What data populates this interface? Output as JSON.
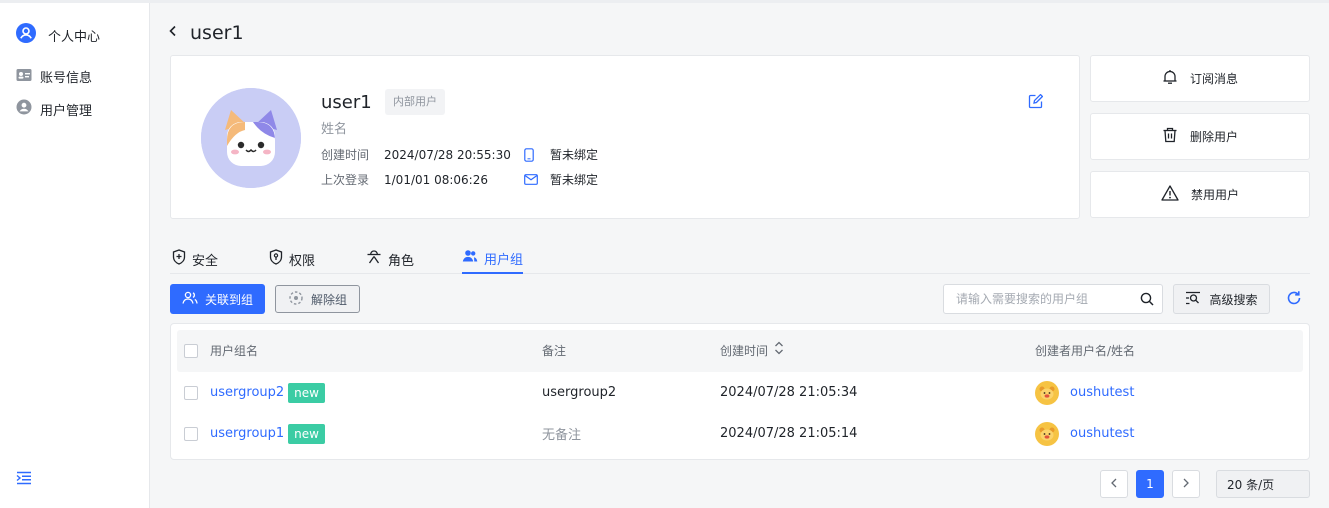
{
  "sidebar": {
    "header_label": "个人中心",
    "items": [
      {
        "label": "账号信息",
        "icon": "id-card-icon"
      },
      {
        "label": "用户管理",
        "icon": "user-circle-icon"
      }
    ]
  },
  "header": {
    "title": "user1"
  },
  "profile": {
    "name": "user1",
    "tag": "内部用户",
    "subtitle": "姓名",
    "created_label": "创建时间",
    "created_value": "2024/07/28 20:55:30",
    "last_login_label": "上次登录",
    "last_login_value": "1/01/01 08:06:26",
    "phone_status": "暂未绑定",
    "email_status": "暂未绑定"
  },
  "actions": {
    "subscribe": "订阅消息",
    "delete": "删除用户",
    "disable": "禁用用户"
  },
  "tabs": [
    {
      "label": "安全",
      "icon": "shield-icon"
    },
    {
      "label": "权限",
      "icon": "shield-lock-icon"
    },
    {
      "label": "角色",
      "icon": "role-icon"
    },
    {
      "label": "用户组",
      "icon": "users-icon",
      "active": true
    }
  ],
  "toolbar": {
    "link_group": "关联到组",
    "unlink_group": "解除组",
    "search_placeholder": "请输入需要搜索的用户组",
    "advanced_search": "高级搜索"
  },
  "table": {
    "columns": [
      "用户组名",
      "备注",
      "创建时间",
      "创建者用户名/姓名"
    ],
    "rows": [
      {
        "name": "usergroup2",
        "badge": "new",
        "remark": "usergroup2",
        "created": "2024/07/28 21:05:34",
        "creator": "oushutest"
      },
      {
        "name": "usergroup1",
        "badge": "new",
        "remark": "无备注",
        "created": "2024/07/28 21:05:14",
        "creator": "oushutest"
      }
    ]
  },
  "pagination": {
    "current": "1",
    "page_size": "20 条/页"
  },
  "colors": {
    "primary": "#2f6bff",
    "badge": "#3bcca4",
    "avatar_bg": "#c9cdf5"
  }
}
